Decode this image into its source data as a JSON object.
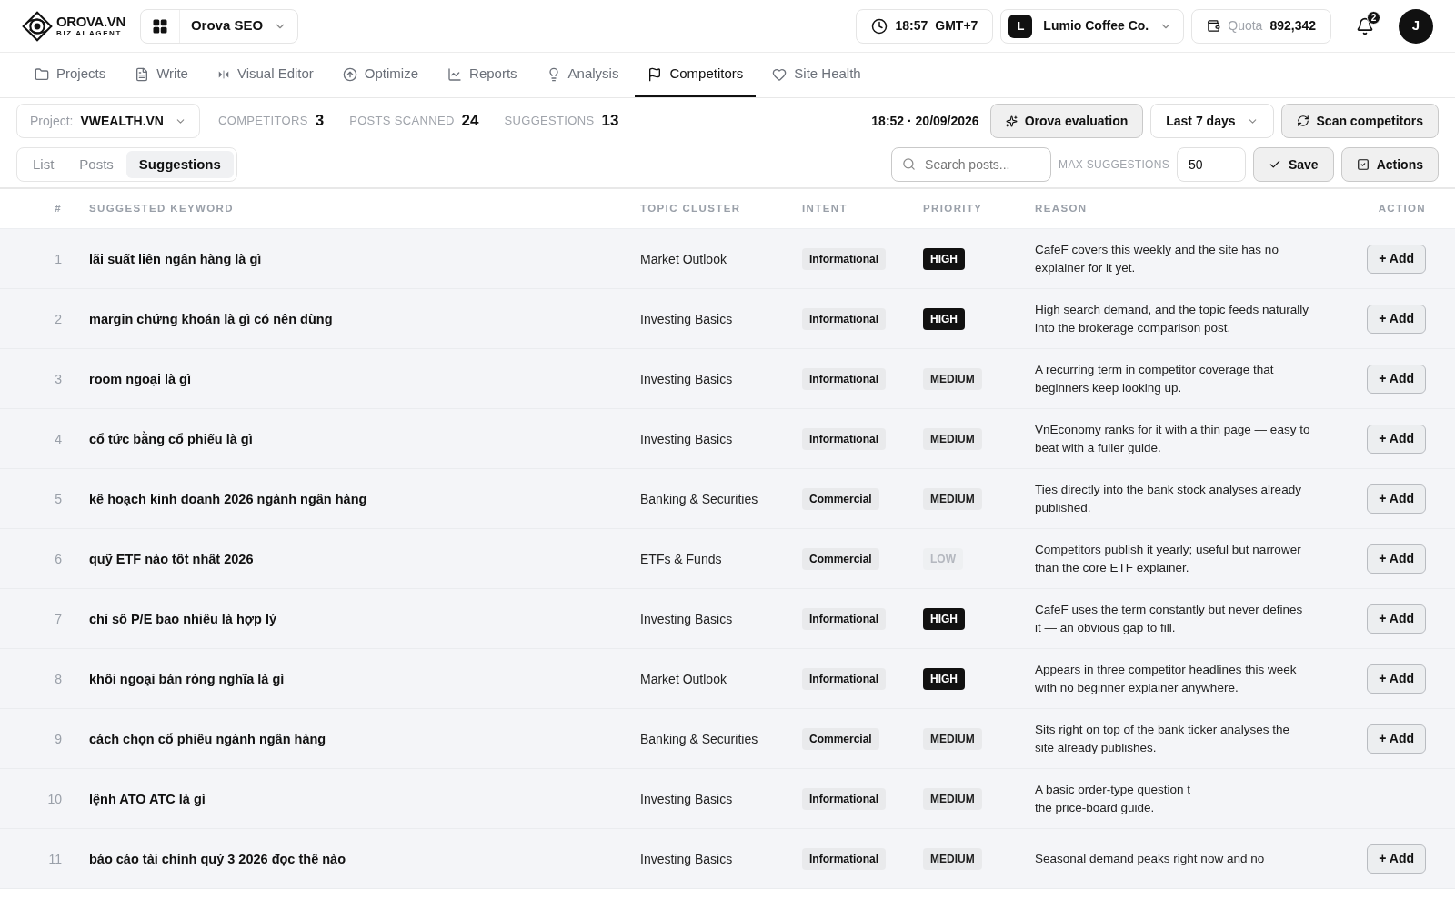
{
  "brand": {
    "name": "OROVA.VN",
    "tagline": "BIZ AI AGENT"
  },
  "app_switcher": {
    "label": "Orova SEO"
  },
  "clock": {
    "time": "18:57",
    "zone": "GMT+7"
  },
  "account": {
    "initial": "L",
    "name": "Lumio Coffee Co."
  },
  "quota": {
    "label": "Quota",
    "value": "892,342"
  },
  "notifications": {
    "count": "2"
  },
  "avatar": {
    "initial": "J"
  },
  "nav_tabs": [
    {
      "label": "Projects",
      "selected": false
    },
    {
      "label": "Write",
      "selected": false
    },
    {
      "label": "Visual Editor",
      "selected": false
    },
    {
      "label": "Optimize",
      "selected": false
    },
    {
      "label": "Reports",
      "selected": false
    },
    {
      "label": "Analysis",
      "selected": false
    },
    {
      "label": "Competitors",
      "selected": true
    },
    {
      "label": "Site Health",
      "selected": false
    }
  ],
  "project": {
    "label": "Project:",
    "value": "VWEALTH.VN"
  },
  "stats": [
    {
      "label": "COMPETITORS",
      "value": "3"
    },
    {
      "label": "POSTS SCANNED",
      "value": "24"
    },
    {
      "label": "SUGGESTIONS",
      "value": "13"
    }
  ],
  "timestamp": "18:52 · 20/09/2026",
  "evaluation_button": "Orova evaluation",
  "range_select": "Last 7 days",
  "scan_button": "Scan competitors",
  "sub_tabs": [
    {
      "label": "List",
      "selected": false
    },
    {
      "label": "Posts",
      "selected": false
    },
    {
      "label": "Suggestions",
      "selected": true
    }
  ],
  "search": {
    "placeholder": "Search posts..."
  },
  "max_suggestions": {
    "label": "MAX SUGGESTIONS",
    "value": "50"
  },
  "save_button": "Save",
  "actions_button": "Actions",
  "table": {
    "columns": [
      "#",
      "SUGGESTED KEYWORD",
      "TOPIC CLUSTER",
      "INTENT",
      "PRIORITY",
      "REASON",
      "ACTION"
    ],
    "rows": [
      {
        "n": "1",
        "keyword": "lãi suất liên ngân hàng là gì",
        "cluster": "Market Outlook",
        "intent": "Informational",
        "priority": "HIGH",
        "kind": "high",
        "reason": [
          "CafeF covers this weekly and the site has no",
          "explainer for it yet."
        ],
        "action": "+ Add"
      },
      {
        "n": "2",
        "keyword": "margin chứng khoán là gì có nên dùng",
        "cluster": "Investing Basics",
        "intent": "Informational",
        "priority": "HIGH",
        "kind": "high",
        "reason": [
          "High search demand, and the topic feeds naturally",
          "into the brokerage comparison post."
        ],
        "action": "+ Add"
      },
      {
        "n": "3",
        "keyword": "room ngoại là gì",
        "cluster": "Investing Basics",
        "intent": "Informational",
        "priority": "MEDIUM",
        "kind": "medium",
        "reason": [
          "A recurring term in competitor coverage that",
          "beginners keep looking up."
        ],
        "action": "+ Add"
      },
      {
        "n": "4",
        "keyword": "cổ tức bằng cổ phiếu là gì",
        "cluster": "Investing Basics",
        "intent": "Informational",
        "priority": "MEDIUM",
        "kind": "medium",
        "reason": [
          "VnEconomy ranks for it with a thin page — easy to",
          "beat with a fuller guide."
        ],
        "action": "+ Add"
      },
      {
        "n": "5",
        "keyword": "kế hoạch kinh doanh 2026 ngành ngân hàng",
        "cluster": "Banking & Securities",
        "intent": "Commercial",
        "priority": "MEDIUM",
        "kind": "medium",
        "reason": [
          "Ties directly into the bank stock analyses already",
          "published."
        ],
        "action": "+ Add"
      },
      {
        "n": "6",
        "keyword": "quỹ ETF nào tốt nhất 2026",
        "cluster": "ETFs & Funds",
        "intent": "Commercial",
        "priority": "LOW",
        "kind": "low",
        "reason": [
          "Competitors publish it yearly; useful but narrower",
          "than the core ETF explainer."
        ],
        "action": "+ Add"
      },
      {
        "n": "7",
        "keyword": "chỉ số P/E bao nhiêu là hợp lý",
        "cluster": "Investing Basics",
        "intent": "Informational",
        "priority": "HIGH",
        "kind": "high",
        "reason": [
          "CafeF uses the term constantly but never defines",
          "it — an obvious gap to fill."
        ],
        "action": "+ Add"
      },
      {
        "n": "8",
        "keyword": "khối ngoại bán ròng nghĩa là gì",
        "cluster": "Market Outlook",
        "intent": "Informational",
        "priority": "HIGH",
        "kind": "high",
        "reason": [
          "Appears in three competitor headlines this week",
          "with no beginner explainer anywhere."
        ],
        "action": "+ Add"
      },
      {
        "n": "9",
        "keyword": "cách chọn cổ phiếu ngành ngân hàng",
        "cluster": "Banking & Securities",
        "intent": "Commercial",
        "priority": "MEDIUM",
        "kind": "medium",
        "reason": [
          "Sits right on top of the bank ticker analyses the",
          "site already publishes."
        ],
        "action": "+ Add"
      },
      {
        "n": "10",
        "keyword": "lệnh ATO ATC là gì",
        "cluster": "Investing Basics",
        "intent": "Informational",
        "priority": "MEDIUM",
        "kind": "medium",
        "reason": [
          "A basic order-type question t",
          "the price-board guide."
        ]
      },
      {
        "n": "11",
        "keyword": "báo cáo tài chính quý 3 2026 đọc thế nào",
        "cluster": "Investing Basics",
        "intent": "Informational",
        "priority": "MEDIUM",
        "kind": "medium",
        "reason": [
          "Seasonal demand peaks right now and no"
        ],
        "action": "+ Add"
      }
    ]
  }
}
